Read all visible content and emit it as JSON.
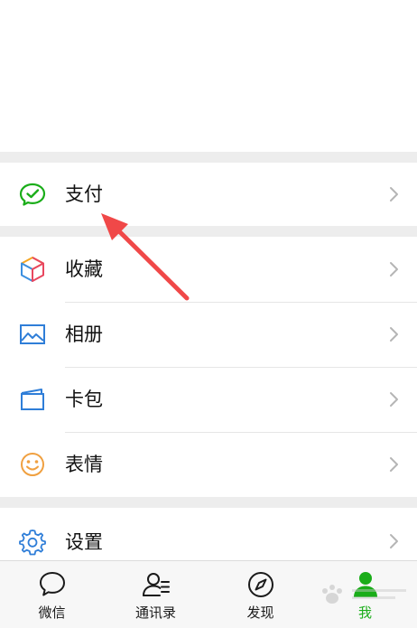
{
  "menu": {
    "payment": {
      "label": "支付",
      "icon": "wechat-pay-icon",
      "color": "#1aad19"
    },
    "favorites": {
      "label": "收藏",
      "icon": "cube-icon"
    },
    "album": {
      "label": "相册",
      "icon": "image-icon",
      "color": "#2f7ed8"
    },
    "cards": {
      "label": "卡包",
      "icon": "card-wallet-icon",
      "color": "#2f7ed8"
    },
    "stickers": {
      "label": "表情",
      "icon": "smiley-icon",
      "color": "#f0a040"
    },
    "settings": {
      "label": "设置",
      "icon": "gear-icon",
      "color": "#2f7ed8"
    }
  },
  "tabbar": {
    "chats": {
      "label": "微信",
      "icon": "chat-bubble-icon"
    },
    "contacts": {
      "label": "通讯录",
      "icon": "contacts-icon"
    },
    "discover": {
      "label": "发现",
      "icon": "compass-icon"
    },
    "me": {
      "label": "我",
      "icon": "person-icon",
      "active": true,
      "color": "#1aad19"
    }
  },
  "annotation": {
    "color": "#f04848"
  }
}
